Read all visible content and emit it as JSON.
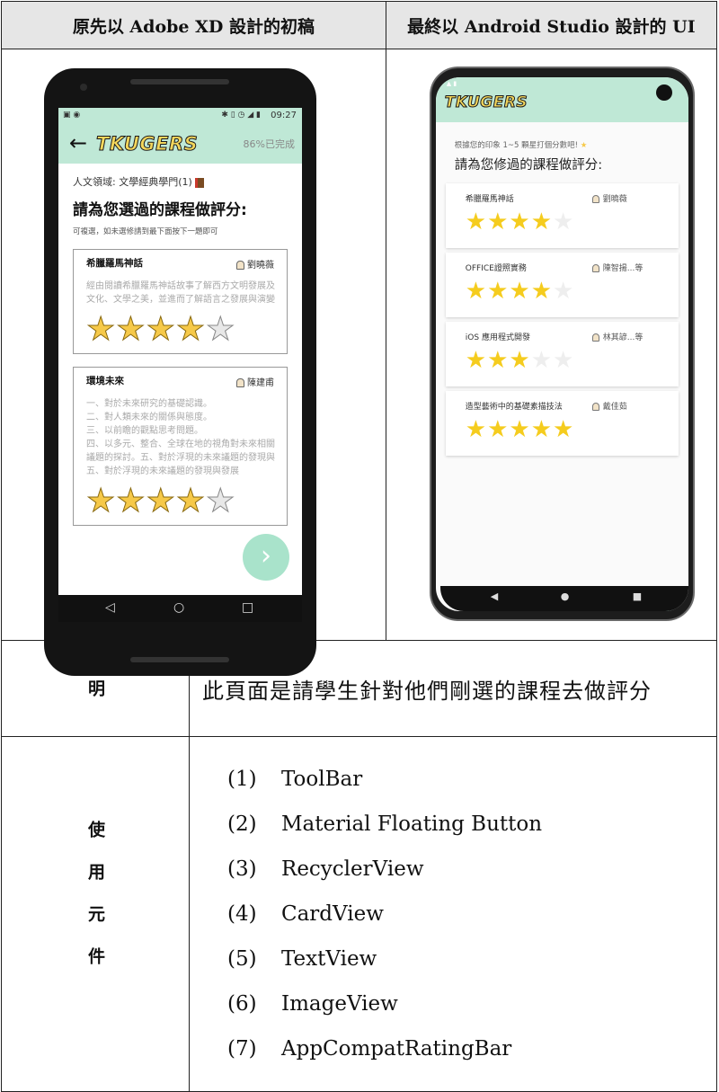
{
  "header": {
    "left": "原先以 Adobe XD 設計的初稿",
    "right": "最終以 Android Studio 設計的 UI"
  },
  "draft": {
    "status_time": "09:27",
    "logo": "TKUGERS",
    "progress": "86%已完成",
    "field": "人文領域: 文學經典學門(1)",
    "title": "請為您選過的課程做評分:",
    "hint": "可複選，如未選修請到最下面按下一題即可",
    "courses": [
      {
        "name": "希臘羅馬神話",
        "teacher": "劉曉薇",
        "desc": "經由閱讀希臘羅馬神話故事了解西方文明發展及文化、文學之美，並進而了解語言之發展與演變",
        "rating": 4
      },
      {
        "name": "環境未來",
        "teacher": "陳建甫",
        "desc": "一、對於未來研究的基礎認識。\n二、對人類未來的關係與態度。\n三、以前瞻的觀點思考問題。\n四、以多元、整合、全球在地的視角對未來相關議題的探討。五、對於浮現的未來議題的發現與\n五、對於浮現的未來議題的發現與發展",
        "rating": 4
      }
    ],
    "fab_icon": "chevron-right-icon",
    "nav": [
      "◁",
      "○",
      "□"
    ]
  },
  "final": {
    "logo": "TKUGERS",
    "hint": "根據您的印象 1~5 顆星打個分數吧!",
    "title": "請為您修過的課程做評分:",
    "courses": [
      {
        "name": "希臘羅馬神話",
        "teacher": "劉曉薇",
        "rating": 4
      },
      {
        "name": "OFFICE證照實務",
        "teacher": "陳智揚...等",
        "rating": 4
      },
      {
        "name": "iOS 應用程式開發",
        "teacher": "林其諺...等",
        "rating": 3
      },
      {
        "name": "造型藝術中的基礎素描技法",
        "teacher": "戴佳茹",
        "rating": 5
      }
    ],
    "fab_icon": "chevron-right-icon",
    "nav": [
      "◀",
      "●",
      "■"
    ]
  },
  "description": {
    "label": "說明",
    "text": "此頁面是請學生針對他們剛選的課程去做評分"
  },
  "components": {
    "label": "使用元件",
    "items": [
      {
        "num": "(1)",
        "name": "ToolBar"
      },
      {
        "num": "(2)",
        "name": "Material Floating Button"
      },
      {
        "num": "(3)",
        "name": "RecyclerView"
      },
      {
        "num": "(4)",
        "name": "CardView"
      },
      {
        "num": "(5)",
        "name": "TextView"
      },
      {
        "num": "(6)",
        "name": "ImageView"
      },
      {
        "num": "(7)",
        "name": "AppCompatRatingBar"
      }
    ]
  },
  "colors": {
    "toolbar": "#bfe8d6",
    "star": "#f6c949",
    "header_bg": "#e6e6e6"
  }
}
